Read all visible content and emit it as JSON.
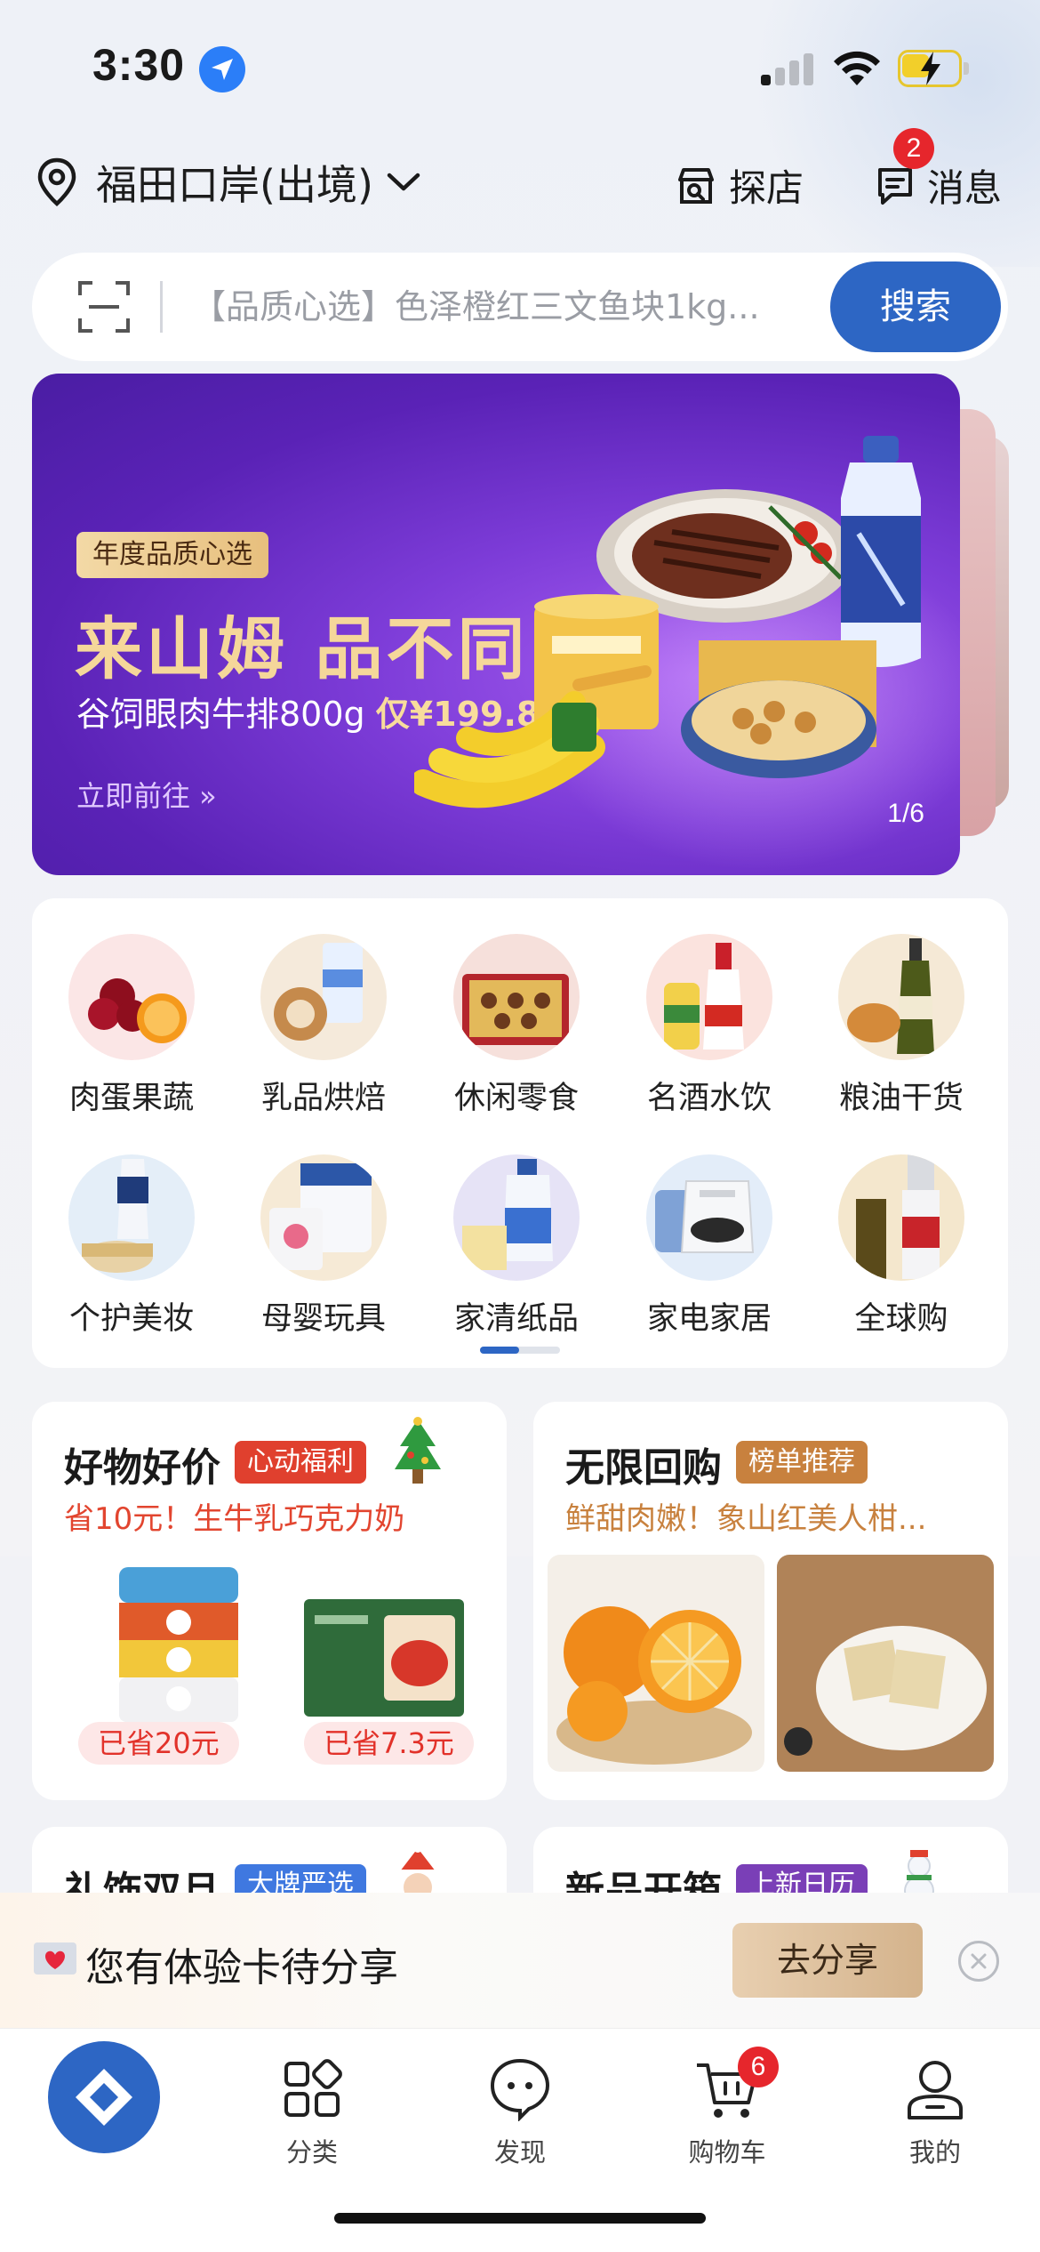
{
  "status_bar": {
    "time": "3:30"
  },
  "header": {
    "location": "福田口岸(出境)",
    "shop_label": "探店",
    "message_label": "消息",
    "message_badge": "2"
  },
  "search": {
    "placeholder": "【品质心选】色泽橙红三文鱼块1kg...",
    "button_label": "搜索"
  },
  "banner": {
    "tag": "年度品质心选",
    "title": "来山姆 品不同",
    "subtitle_prefix": "谷饲眼肉牛排800g ",
    "subtitle_price": "仅¥199.8",
    "cta": "立即前往 »",
    "pager": "1/6"
  },
  "categories": [
    {
      "label": "肉蛋果蔬",
      "icon": "fruit-icon"
    },
    {
      "label": "乳品烘焙",
      "icon": "milk-icon"
    },
    {
      "label": "休闲零食",
      "icon": "snack-icon"
    },
    {
      "label": "名酒水饮",
      "icon": "liquor-icon"
    },
    {
      "label": "粮油干货",
      "icon": "oil-icon"
    },
    {
      "label": "个护美妆",
      "icon": "cosmetics-icon"
    },
    {
      "label": "母婴玩具",
      "icon": "baby-icon"
    },
    {
      "label": "家清纸品",
      "icon": "detergent-icon"
    },
    {
      "label": "家电家居",
      "icon": "appliance-icon"
    },
    {
      "label": "全球购",
      "icon": "global-icon"
    }
  ],
  "promos": [
    {
      "title": "好物好价",
      "pill": "心动福利",
      "pill_color": "#e0402e",
      "subtitle": "省10元！生牛乳巧克力奶",
      "subtitle_color": "#e2452f",
      "saved": [
        "已省20元",
        "已省7.3元"
      ]
    },
    {
      "title": "无限回购",
      "pill": "榜单推荐",
      "pill_color": "#c8813e",
      "subtitle": "鲜甜肉嫩！象山红美人柑...",
      "subtitle_color": "#c8813e"
    }
  ],
  "promos_row2": [
    {
      "title": "礼饰双旦",
      "pill": "大牌严选",
      "pill_color": "#3f78e0"
    },
    {
      "title": "新品开箱",
      "pill": "上新日历",
      "pill_color": "#7a3fb7"
    }
  ],
  "share_bar": {
    "message": "您有体验卡待分享",
    "button_label": "去分享"
  },
  "tabbar": {
    "tabs": [
      {
        "label": "分类",
        "icon": "category-icon"
      },
      {
        "label": "发现",
        "icon": "discover-icon"
      },
      {
        "label": "购物车",
        "icon": "cart-icon"
      },
      {
        "label": "我的",
        "icon": "profile-icon"
      }
    ],
    "cart_badge": "6"
  },
  "colors": {
    "brand_blue": "#2d66c4",
    "badge_red": "#e6262c",
    "banner_purple": "#5a22b6",
    "banner_gold": "#f5d79a"
  }
}
